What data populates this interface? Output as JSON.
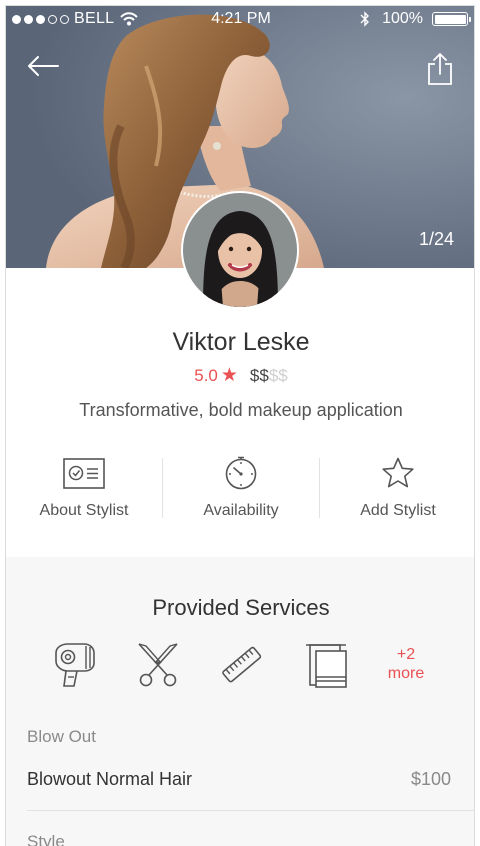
{
  "status_bar": {
    "carrier": "BELL",
    "time": "4:21 PM",
    "battery": "100%",
    "signal_bars_filled": 3,
    "signal_bars_total": 5
  },
  "hero": {
    "photo_counter": "1/24",
    "back_icon": "back-arrow-icon",
    "share_icon": "share-icon"
  },
  "profile": {
    "name": "Viktor Leske",
    "rating": "5.0",
    "price_active": "$$",
    "price_inactive": "$$",
    "tagline": "Transformative, bold makeup application"
  },
  "actions": [
    {
      "label": "About Stylist",
      "icon": "id-card-icon"
    },
    {
      "label": "Availability",
      "icon": "clock-icon"
    },
    {
      "label": "Add Stylist",
      "icon": "star-outline-icon"
    }
  ],
  "services": {
    "title": "Provided Services",
    "icons": [
      "hair-dryer-icon",
      "scissors-icon",
      "comb-icon",
      "towel-icon"
    ],
    "more_count": "+2",
    "more_label": "more",
    "categories": [
      {
        "label": "Blow Out",
        "items": [
          {
            "name": "Blowout Normal Hair",
            "price": "$100"
          }
        ]
      },
      {
        "label": "Style",
        "items": []
      }
    ]
  },
  "colors": {
    "accent": "#ea5153",
    "text_primary": "#333333",
    "text_secondary": "#8a8a8a",
    "section_bg": "#f7f7f7"
  }
}
